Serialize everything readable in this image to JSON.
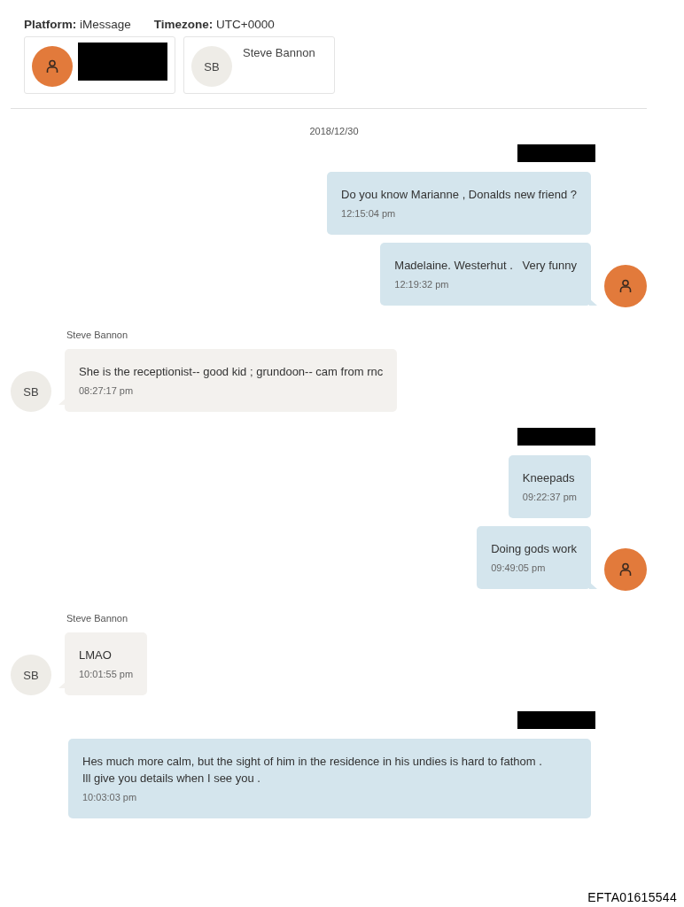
{
  "header": {
    "fields": [
      {
        "label": "Platform:",
        "value": "iMessage"
      },
      {
        "label": "Timezone:",
        "value": "UTC+0000"
      }
    ],
    "participants": [
      {
        "kind": "self",
        "redacted": true
      },
      {
        "kind": "contact",
        "initials": "SB",
        "name": "Steve Bannon"
      }
    ]
  },
  "date": "2018/12/30",
  "groups": [
    {
      "kind": "out",
      "sender_redacted": true,
      "messages": [
        {
          "text": "Do you know Marianne , Donalds new friend ?",
          "time": "12:15:04 pm",
          "avatar": false
        },
        {
          "text": "Madelaine. Westerhut .   Very funny",
          "time": "12:19:32 pm",
          "avatar": true
        }
      ]
    },
    {
      "kind": "in",
      "sender": "Steve Bannon",
      "initials": "SB",
      "messages": [
        {
          "text": "She is the receptionist-- good kid ; grundoon-- cam from rnc",
          "time": "08:27:17 pm",
          "avatar": true
        }
      ]
    },
    {
      "kind": "out",
      "sender_redacted": true,
      "messages": [
        {
          "text": "Kneepads",
          "time": "09:22:37 pm",
          "avatar": false
        },
        {
          "text": "Doing gods work",
          "time": "09:49:05 pm",
          "avatar": true
        }
      ]
    },
    {
      "kind": "in",
      "sender": "Steve Bannon",
      "initials": "SB",
      "messages": [
        {
          "text": "LMAO",
          "time": "10:01:55 pm",
          "avatar": true
        }
      ]
    },
    {
      "kind": "out",
      "sender_redacted": true,
      "messages": [
        {
          "text": "Hes much more calm, but the sight of him in the residence in his undies is hard to fathom .  Ill give you details when I see you .",
          "time": "10:03:03 pm",
          "avatar": false
        }
      ]
    }
  ],
  "stamp": "EFTA01615544"
}
